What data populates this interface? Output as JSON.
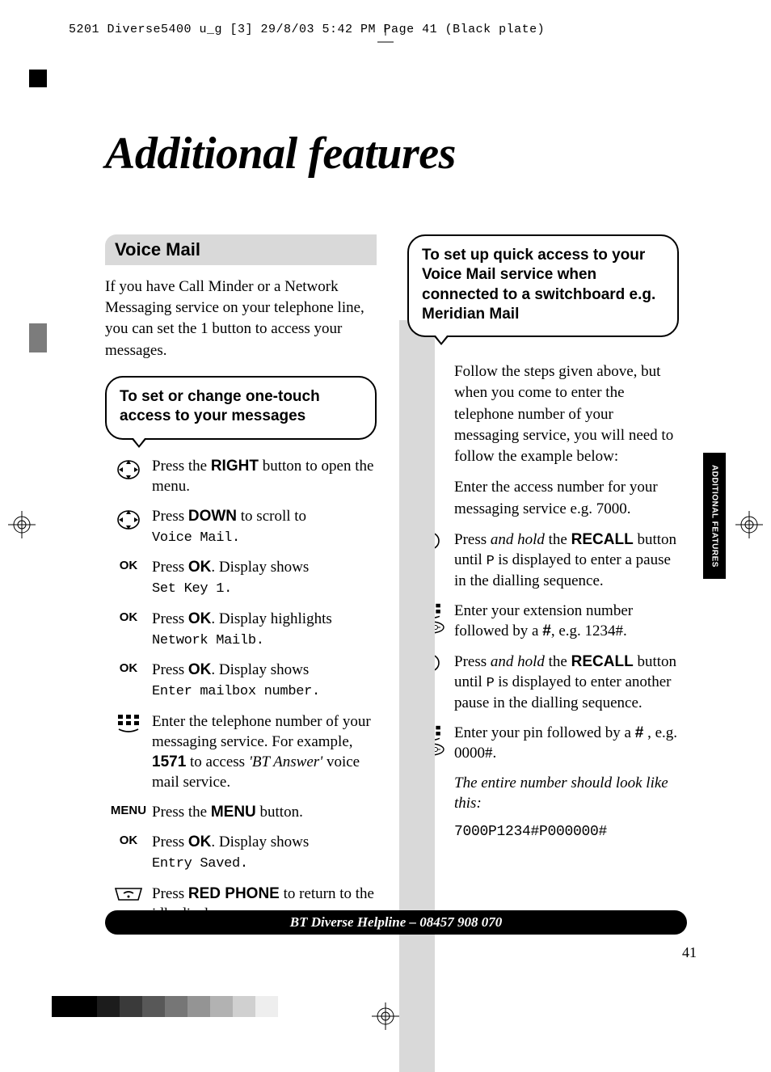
{
  "print_header": "5201 Diverse5400  u_g [3]  29/8/03  5:42 PM  Page 41   (Black plate)",
  "title": "Additional features",
  "section_heading": "Voice Mail",
  "intro": "If you have Call Minder or a Network Messaging service on your telephone line, you can set the 1 button to access your messages.",
  "callout_left": "To set or change one-touch access to your messages",
  "steps": [
    {
      "icon": "nav",
      "pre": "Press the ",
      "b": "RIGHT",
      "post": " button to open the menu."
    },
    {
      "icon": "nav",
      "pre": "Press ",
      "b": "DOWN",
      "post": " to scroll to ",
      "lcd": "Voice Mail."
    },
    {
      "icon": "ok",
      "pre": "Press ",
      "b": "OK",
      "post": ". Display shows ",
      "lcd": "Set Key 1."
    },
    {
      "icon": "ok",
      "pre": "Press ",
      "b": "OK",
      "post": ". Display highlights ",
      "lcd": "Network Mailb."
    },
    {
      "icon": "ok",
      "pre": "Press ",
      "b": "OK",
      "post": ". Display shows ",
      "lcd": "Enter mailbox number."
    },
    {
      "icon": "keypad",
      "pre": "Enter the telephone number of your messaging service. For example, ",
      "b": "1571",
      "post": " to access ",
      "ital": "'BT Answer'",
      "post2": " voice mail service."
    },
    {
      "icon": "menu",
      "pre": "Press the ",
      "b": "MENU",
      "post": " button."
    },
    {
      "icon": "ok",
      "pre": "Press ",
      "b": "OK",
      "post": ". Display shows ",
      "lcd": "Entry Saved."
    },
    {
      "icon": "redphone",
      "pre": "Press ",
      "b": "RED PHONE",
      "post": " to return to the idle display."
    }
  ],
  "callout_right": "To set up quick access to your Voice Mail service when connected to a switchboard e.g. Meridian Mail",
  "right_intro1": "Follow the steps given above, but when you come to enter the telephone number of your messaging service, you will need to follow the example below:",
  "right_intro2": "Enter the access number for your messaging service e.g. 7000.",
  "rsteps": [
    {
      "icon": "recall",
      "text_pre": "Press ",
      "ital": "and hold",
      "mid": " the ",
      "b": "RECALL",
      "post": " button until ",
      "lcd": "P",
      "post2": " is displayed to enter a pause in the dialling sequence."
    },
    {
      "icon": "keypad-redial",
      "text": "Enter your extension number followed by a ",
      "hash": "#",
      "post": ", e.g. 1234#."
    },
    {
      "icon": "recall",
      "text_pre": "Press ",
      "ital": "and hold",
      "mid": " the ",
      "b": "RECALL",
      "post": " button until ",
      "lcd": "P",
      "post2": " is displayed to enter another pause in the dialling sequence."
    },
    {
      "icon": "keypad-redial",
      "text": "Enter your pin followed by a ",
      "hash": "#",
      "post": " , e.g. 0000#."
    }
  ],
  "right_outro_italic": "The entire number should look like this:",
  "right_outro_lcd": "7000P1234#P000000#",
  "footer": "BT Diverse Helpline – 08457 908 070",
  "page_number": "41",
  "side_tab": "ADDITIONAL FEATURES",
  "swatches": [
    "#000000",
    "#000000",
    "#1c1c1c",
    "#3a3a3a",
    "#585858",
    "#767676",
    "#949494",
    "#b2b2b2",
    "#d0d0d0",
    "#eeeeee"
  ]
}
